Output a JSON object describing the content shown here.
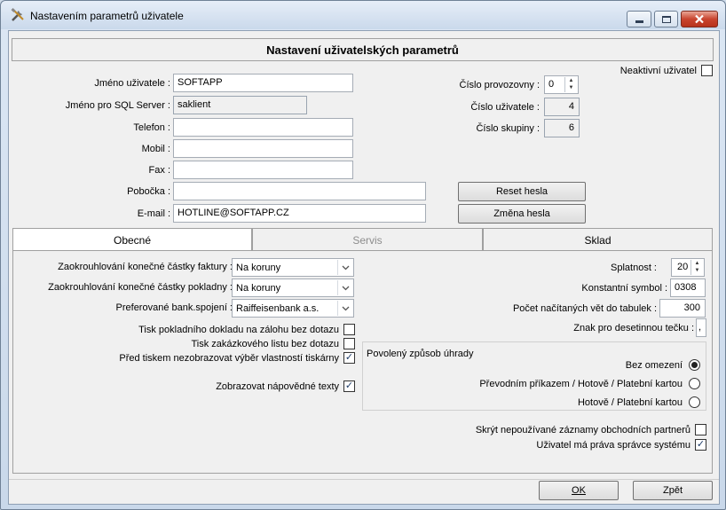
{
  "window": {
    "title": "Nastavením parametrů uživatele"
  },
  "header": {
    "title": "Nastavení uživatelských parametrů"
  },
  "user": {
    "username_label": "Jméno uživatele :",
    "username_value": "SOFTAPP",
    "sql_label": "Jméno pro SQL Server :",
    "sql_value": "saklient",
    "phone_label": "Telefon :",
    "phone_value": "",
    "mobile_label": "Mobil :",
    "mobile_value": "",
    "fax_label": "Fax :",
    "fax_value": "",
    "branch_label": "Pobočka :",
    "branch_value": "",
    "email_label": "E-mail :",
    "email_value": "HOTLINE@SOFTAPP.CZ",
    "inactive_label": "Neaktivní uživatel",
    "branch_no_label": "Číslo provozovny :",
    "branch_no_value": "0",
    "user_no_label": "Číslo uživatele :",
    "user_no_value": "4",
    "group_no_label": "Číslo skupiny :",
    "group_no_value": "6",
    "reset_password": "Reset hesla",
    "change_password": "Změna hesla"
  },
  "tabs": [
    {
      "label": "Obecné",
      "state": "active"
    },
    {
      "label": "Servis",
      "state": "disabled"
    },
    {
      "label": "Sklad",
      "state": "normal"
    }
  ],
  "general": {
    "round_invoice_label": "Zaokrouhlování konečné částky faktury :",
    "round_invoice_value": "Na koruny",
    "round_receipt_label": "Zaokrouhlování konečné částky pokladny :",
    "round_receipt_value": "Na koruny",
    "bank_label": "Preferované bank.spojení :",
    "bank_value": "Raiffeisenbank a.s.",
    "print_receipt_label": "Tisk pokladního dokladu na zálohu bez dotazu",
    "print_receipt_checked": false,
    "print_order_label": "Tisk zakázkového listu bez dotazu",
    "print_order_checked": false,
    "hide_printer_label": "Před tiskem nezobrazovat výběr vlastností tiskárny",
    "hide_printer_checked": true,
    "show_help_label": "Zobrazovat nápovědné texty",
    "show_help_checked": true,
    "due_label": "Splatnost :",
    "due_value": "20",
    "const_symbol_label": "Konstantní symbol :",
    "const_symbol_value": "0308",
    "rows_label": "Počet načítaných vět do tabulek :",
    "rows_value": "300",
    "decimal_label": "Znak pro desetinnou tečku :",
    "decimal_value": ",",
    "payment_group_label": "Povolený způsob úhrady",
    "payment_options": [
      {
        "label": "Bez omezení",
        "selected": true
      },
      {
        "label": "Převodním příkazem / Hotově / Platební kartou",
        "selected": false
      },
      {
        "label": "Hotově / Platební kartou",
        "selected": false
      }
    ],
    "hide_unused_label": "Skrýt nepoužívané záznamy obchodních partnerů",
    "hide_unused_checked": false,
    "admin_label": "Uživatel má práva správce systému",
    "admin_checked": true
  },
  "footer": {
    "ok_label": "OK",
    "back_label": "Zpět"
  }
}
